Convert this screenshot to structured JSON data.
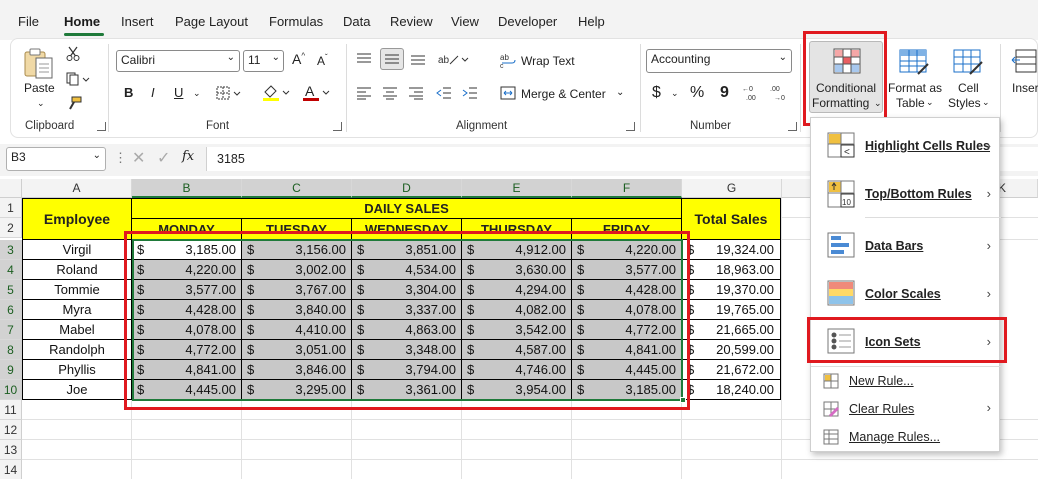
{
  "menu_tabs": [
    "File",
    "Home",
    "Insert",
    "Page Layout",
    "Formulas",
    "Data",
    "Review",
    "View",
    "Developer",
    "Help"
  ],
  "ribbon": {
    "clipboard": {
      "label": "Clipboard",
      "paste": "Paste"
    },
    "font": {
      "label": "Font",
      "name": "Calibri",
      "size": "11"
    },
    "alignment": {
      "label": "Alignment",
      "wrap_text": "Wrap Text",
      "merge_center": "Merge & Center"
    },
    "number": {
      "label": "Number",
      "format": "Accounting",
      "currency": "$",
      "percent": "%",
      "comma": "9"
    },
    "styles": {
      "conditional_formatting_1": "Conditional",
      "conditional_formatting_2": "Formatting",
      "format_as_table_1": "Format as",
      "format_as_table_2": "Table",
      "cell_styles_1": "Cell",
      "cell_styles_2": "Styles"
    },
    "cells": {
      "insert": "Inser"
    }
  },
  "formula_bar": {
    "name_box": "B3",
    "fx": "fx",
    "value": "3185"
  },
  "columns": [
    "A",
    "B",
    "C",
    "D",
    "E",
    "F",
    "G",
    "K"
  ],
  "rows": [
    "1",
    "2",
    "3",
    "4",
    "5",
    "6",
    "7",
    "8",
    "9",
    "10",
    "11",
    "12",
    "13",
    "14"
  ],
  "sheet": {
    "employee_header": "Employee",
    "daily_sales_header": "DAILY SALES",
    "total_header": "Total Sales",
    "days": [
      "MONDAY",
      "TUESDAY",
      "WEDNESDAY",
      "THURSDAY",
      "FRIDAY"
    ],
    "currency_symbol": "$",
    "records": [
      {
        "name": "Virgil",
        "sales": [
          "3,185.00",
          "3,156.00",
          "3,851.00",
          "4,912.00",
          "4,220.00"
        ],
        "total": "19,324.00"
      },
      {
        "name": "Roland",
        "sales": [
          "4,220.00",
          "3,002.00",
          "4,534.00",
          "3,630.00",
          "3,577.00"
        ],
        "total": "18,963.00"
      },
      {
        "name": "Tommie",
        "sales": [
          "3,577.00",
          "3,767.00",
          "3,304.00",
          "4,294.00",
          "4,428.00"
        ],
        "total": "19,370.00"
      },
      {
        "name": "Myra",
        "sales": [
          "4,428.00",
          "3,840.00",
          "3,337.00",
          "4,082.00",
          "4,078.00"
        ],
        "total": "19,765.00"
      },
      {
        "name": "Mabel",
        "sales": [
          "4,078.00",
          "4,410.00",
          "4,863.00",
          "3,542.00",
          "4,772.00"
        ],
        "total": "21,665.00"
      },
      {
        "name": "Randolph",
        "sales": [
          "4,772.00",
          "3,051.00",
          "3,348.00",
          "4,587.00",
          "4,841.00"
        ],
        "total": "20,599.00"
      },
      {
        "name": "Phyllis",
        "sales": [
          "4,841.00",
          "3,846.00",
          "3,794.00",
          "4,746.00",
          "4,445.00"
        ],
        "total": "21,672.00"
      },
      {
        "name": "Joe",
        "sales": [
          "4,445.00",
          "3,295.00",
          "3,361.00",
          "3,954.00",
          "3,185.00"
        ],
        "total": "18,240.00"
      }
    ]
  },
  "cf_menu": {
    "highlight": "Highlight Cells Rules",
    "topbottom": "Top/Bottom Rules",
    "databars": "Data Bars",
    "colorscales": "Color Scales",
    "iconsets": "Icon Sets",
    "newrule": "New Rule...",
    "clearrules": "Clear Rules",
    "managerules": "Manage Rules..."
  },
  "colors": {
    "header_yellow": "#ffff00",
    "selection_gray": "#c8c8c8",
    "accent_green": "#1f7a3a",
    "highlight_red": "#e0191f"
  }
}
